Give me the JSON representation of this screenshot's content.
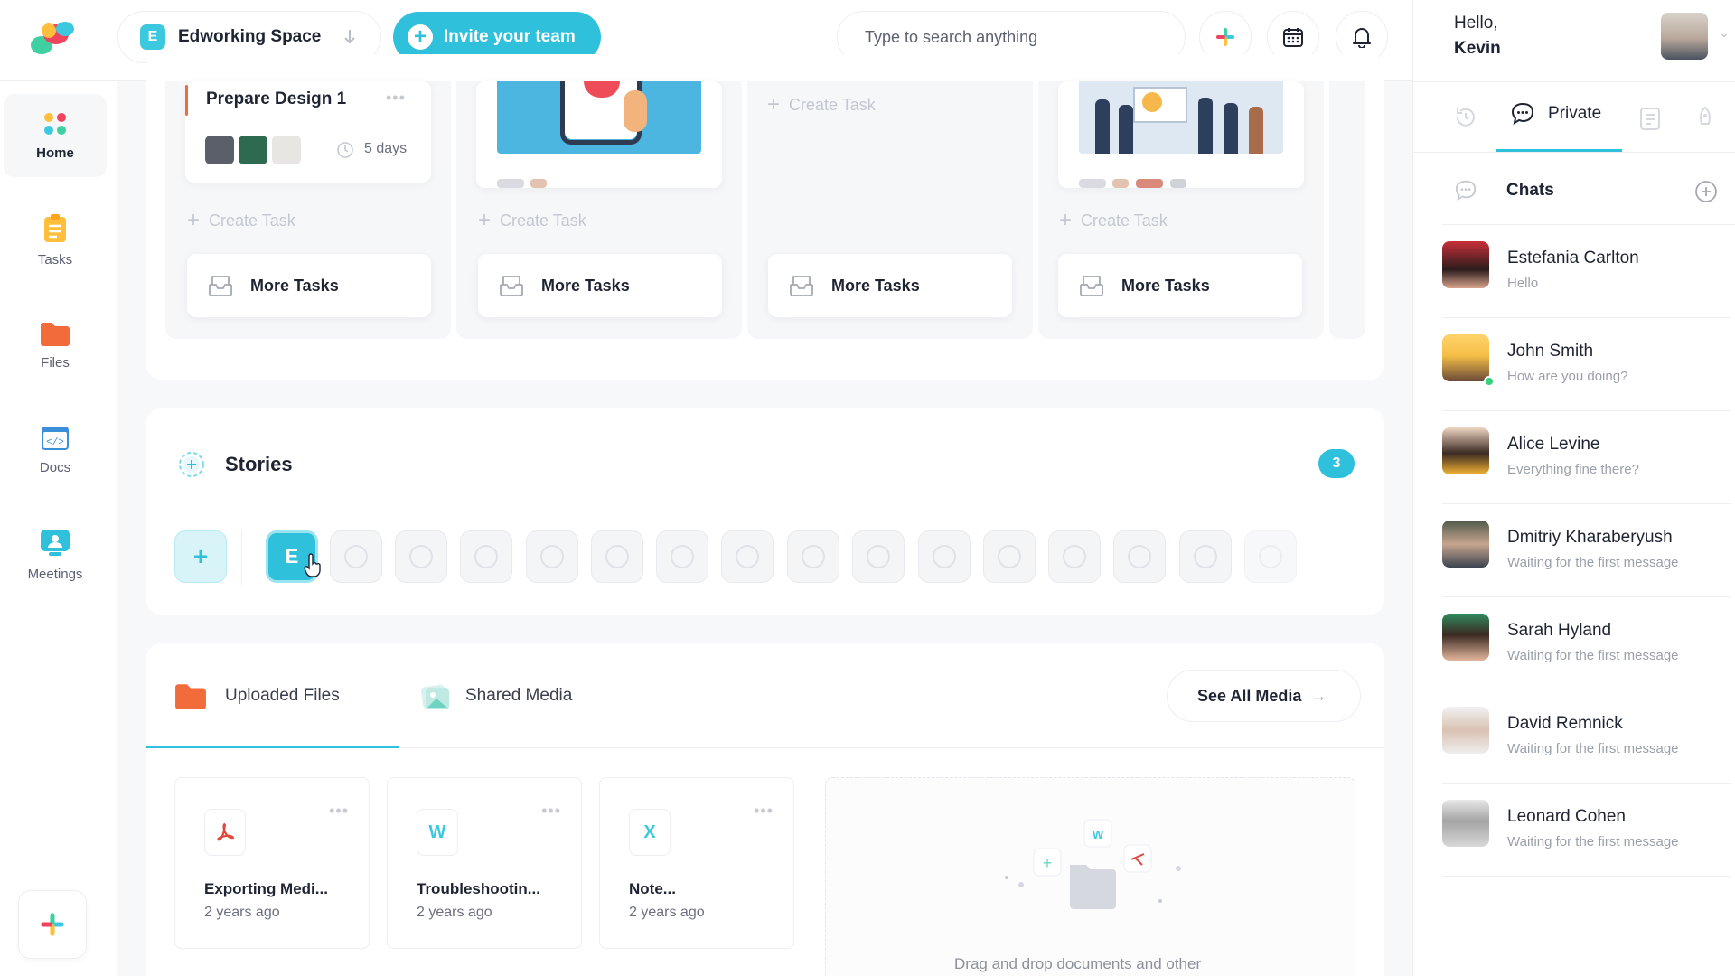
{
  "topbar": {
    "workspace_badge": "E",
    "workspace_name": "Edworking Space",
    "invite_label": "Invite your team",
    "search_placeholder": "Type to search anything"
  },
  "user": {
    "greeting": "Hello,",
    "name": "Kevin"
  },
  "nav": {
    "items": [
      {
        "label": "Home",
        "icon": "home-icon"
      },
      {
        "label": "Tasks",
        "icon": "tasks-icon"
      },
      {
        "label": "Files",
        "icon": "folder-icon"
      },
      {
        "label": "Docs",
        "icon": "docs-icon"
      },
      {
        "label": "Meetings",
        "icon": "meetings-icon"
      }
    ]
  },
  "board": {
    "task_title": "Prepare Design 1",
    "task_due": "5 days",
    "create_task_label": "Create Task",
    "more_tasks_label": "More Tasks"
  },
  "stories": {
    "title": "Stories",
    "count": "3",
    "user_story_letter": "E"
  },
  "files": {
    "tab_uploaded": "Uploaded Files",
    "tab_shared": "Shared Media",
    "see_all": "See All Media",
    "items": [
      {
        "letter": "",
        "type": "pdf",
        "name": "Exporting Medi...",
        "date": "2 years ago"
      },
      {
        "letter": "W",
        "type": "word",
        "name": "Troubleshootin...",
        "date": "2 years ago"
      },
      {
        "letter": "X",
        "type": "excel",
        "name": "Note...",
        "date": "2 years ago"
      }
    ],
    "dropzone_text": "Drag and drop documents and other"
  },
  "chat_panel": {
    "tab_private": "Private",
    "chats_title": "Chats",
    "chats": [
      {
        "name": "Estefania Carlton",
        "message": "Hello"
      },
      {
        "name": "John Smith",
        "message": "How are you doing?"
      },
      {
        "name": "Alice Levine",
        "message": "Everything fine there?"
      },
      {
        "name": "Dmitriy Kharaberyush",
        "message": "Waiting for the first message"
      },
      {
        "name": "Sarah Hyland",
        "message": "Waiting for the first message"
      },
      {
        "name": "David Remnick",
        "message": "Waiting for the first message"
      },
      {
        "name": "Leonard Cohen",
        "message": "Waiting for the first message"
      }
    ]
  },
  "colors": {
    "accent": "#2fc0db",
    "folder": "#f26b3a",
    "pdf": "#e0483b",
    "word": "#3cc9e0",
    "online": "#35d17b"
  }
}
